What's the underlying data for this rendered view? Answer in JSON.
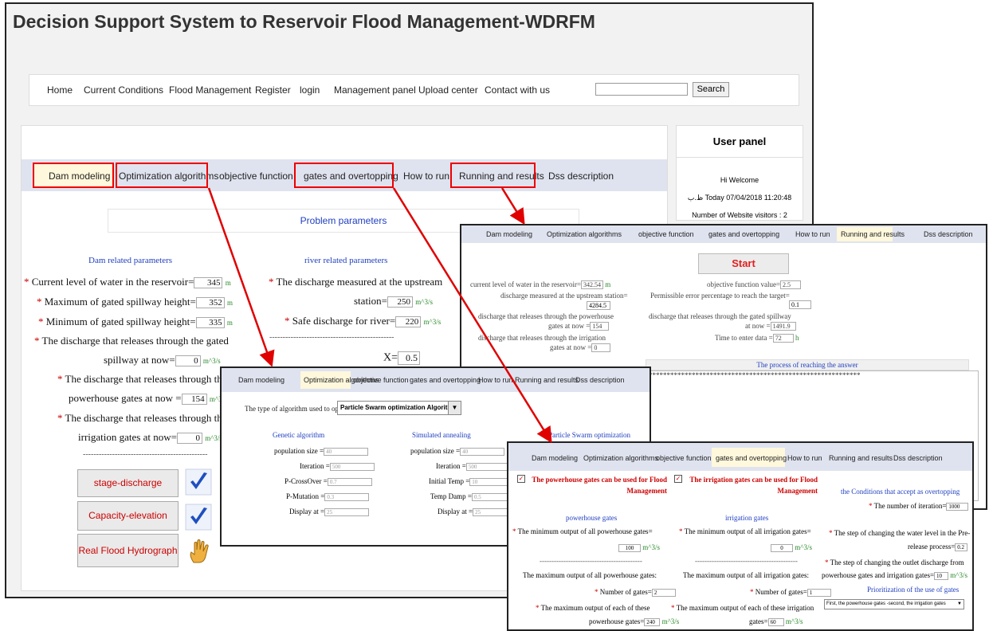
{
  "app": {
    "title": "Decision Support System to Reservoir Flood Management-WDRFM"
  },
  "nav": {
    "items": [
      "Home",
      "Current Conditions",
      "Flood Management",
      "Register",
      "login",
      "Management panel",
      "Upload center",
      "Contact with us"
    ],
    "search_label": "Search",
    "search_value": ""
  },
  "tabs": [
    "Dam modeling",
    "Optimization algorithms",
    "objective function",
    "gates and overtopping",
    "How to run",
    "Running and results",
    "Dss description"
  ],
  "user_panel": {
    "title": "User panel",
    "welcome": "Hi Welcome",
    "today": "ظ.ب Today 07/04/2018 11:20:48",
    "visitors": "Number of Website visitors : 2"
  },
  "dam": {
    "section_title": "Problem parameters",
    "dam_header": "Dam related parameters",
    "river_header": "river related parameters",
    "current_level_label": "Current level of water in the reservoir=",
    "current_level": "345",
    "unit_m": "m",
    "max_gated_label": "Maximum of gated spillway height=",
    "max_gated": "352",
    "min_gated_label": "Minimum of gated spillway height=",
    "min_gated": "335",
    "spill_label_1": "The discharge that releases through the gated",
    "spill_label_2": "spillway at now=",
    "spill": "0",
    "unit_q": "m^3/s",
    "power_label_1": "The discharge that releases through the",
    "power_label_2": "powerhouse gates at now =",
    "power": "154",
    "irr_label_1": "The discharge that releases through the",
    "irr_label_2": "irrigation gates at now=",
    "irr": "0",
    "upstream_label_1": "The discharge measured at the upstream",
    "upstream_label_2": "station=",
    "upstream": "250",
    "safe_label": "Safe discharge for river=",
    "safe": "220",
    "dashes": "-----------------------------------------------",
    "x_label": "X=",
    "x": "0.5",
    "btn_stage": "stage-discharge relation",
    "btn_capacity": "Capacity-elevation curve",
    "btn_flood": "Real Flood Hydrograph"
  },
  "results": {
    "start": "Start",
    "level_label": "current level of water in the reservoir=",
    "level": "342.54",
    "unit_m": "m",
    "upstream_label": "discharge measured at the upstream station=",
    "upstream": "4284.5",
    "power_label_1": "discharge that releases through the powerhouse",
    "power_label_2": "gates at now =",
    "power": "154",
    "irr_label_1": "discharge that releases through the irrigation",
    "irr_label_2": "gates at now =",
    "irr": "0",
    "obj_label": "objective function value=",
    "obj": "2.5",
    "err_label": "Permissible error percentage to reach the target=",
    "err": "0.1",
    "spill_label_1": "discharge that releases through the gated spillway",
    "spill_label_2": "at now =",
    "spill": "1491.9",
    "time_label": "Time to enter data =",
    "time": "72",
    "unit_h": "h",
    "process_title": "The process of reaching the answer",
    "process_text": "***********************************************************"
  },
  "optim": {
    "type_label": "The type of algorithm used to optimize=",
    "type_value": "Particle Swarm optimization Algorithm",
    "genetic": "Genetic algorithm",
    "sa": "Simulated annealing",
    "pso": "Particle Swarm optimization",
    "g_pop_label": "population size =",
    "g_pop": "40",
    "g_iter_label": "Iteration =",
    "g_iter": "500",
    "g_pc_label": "P-CrossOver =",
    "g_pc": "0.7",
    "g_pm_label": "P-Mutation =",
    "g_pm": "0.3",
    "g_disp_label": "Display at =",
    "g_disp": "25",
    "s_pop_label": "population size =",
    "s_pop": "40",
    "s_iter_label": "Iteration =",
    "s_iter": "500",
    "s_temp_label": "Initial Temp =",
    "s_temp": "10",
    "s_damp_label": "Temp Damp =",
    "s_damp": "0.5",
    "s_disp_label": "Display at =",
    "s_disp": "25"
  },
  "gates": {
    "ph_check": "The powerhouse gates can be used for Flood Management",
    "ir_check": "The irrigation gates can be used for Flood Management",
    "cond_title": "the Conditions that accept as overtopping",
    "iter_label": "The number of iteration=",
    "iter": "1000",
    "ph_header": "powerhouse gates",
    "ir_header": "irrigation gates",
    "ph_min_label": "The minimum output of all powerhouse gates=",
    "ph_min": "100",
    "ir_min_label": "The minimum output of all irrigation gates=",
    "ir_min": "0",
    "step_level_1": "The step of changing the water level in the Pre-",
    "step_level_2": "release process=",
    "step_level": "0.2",
    "step_dis_1": "The step of changing the outlet discharge from",
    "step_dis_2": "powerhouse gates and irrigation gates=",
    "step_dis": "10",
    "dashes": "-------------------------------------------",
    "ph_max_label": "The maximum output of all powerhouse gates:",
    "ir_max_label": "The maximum output of all irrigation gates:",
    "prio_title": "Prioritization of the use of gates",
    "ph_num_label": "Number of gates=",
    "ph_num": "2",
    "ir_num_label": "Number of gates=",
    "ir_num": "1",
    "prio_value": "First, the powerhouse gates -second, the irrigation gates",
    "ph_each_1": "The maximum output of each of these",
    "ph_each_2": "powerhouse gates=",
    "ph_each": "240",
    "ir_each_1": "The maximum output of each of these irrigation",
    "ir_each_2": "gates=",
    "ir_each": "60"
  },
  "colors": {
    "red": "#e00000",
    "tab_bg": "#dfe3ef",
    "active_tab": "#fff8dc"
  }
}
